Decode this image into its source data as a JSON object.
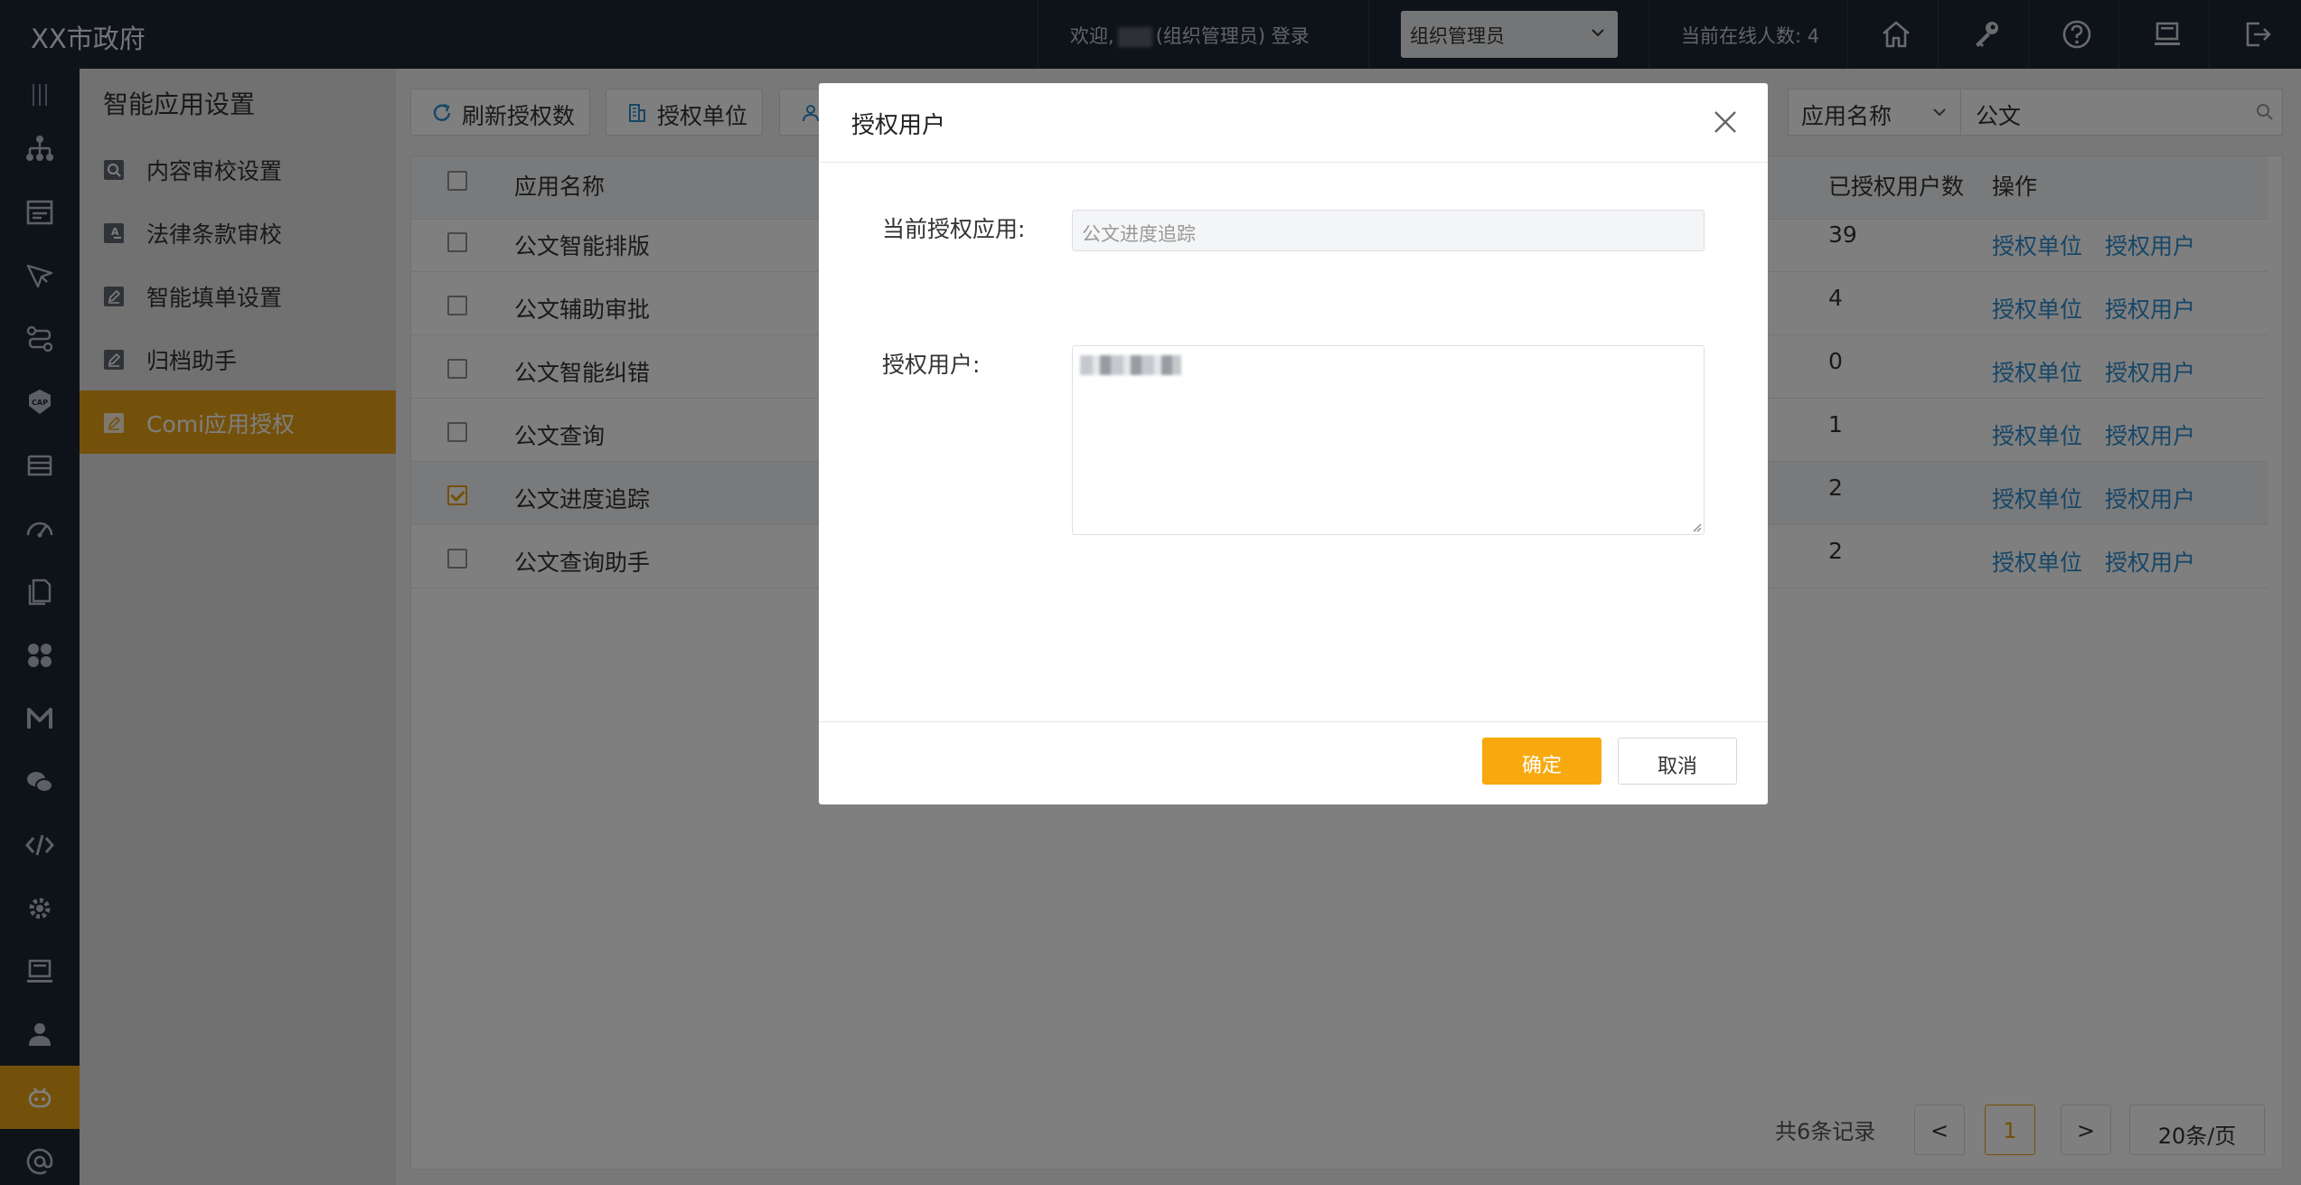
{
  "header": {
    "title": "XX市政府",
    "welcome_prefix": "欢迎,",
    "welcome_suffix": "(组织管理员) 登录",
    "role_value": "组织管理员",
    "online_text": "当前在线人数: 4"
  },
  "subnav": {
    "title": "智能应用设置",
    "items": [
      {
        "label": "内容审校设置"
      },
      {
        "label": "法律条款审校"
      },
      {
        "label": "智能填单设置"
      },
      {
        "label": "归档助手"
      },
      {
        "label": "Comi应用授权"
      }
    ]
  },
  "toolbar": {
    "refresh_label": "刷新授权数",
    "auth_unit_label": "授权单位",
    "search_type": "应用名称",
    "search_value": "公文"
  },
  "table": {
    "headers": {
      "name": "应用名称",
      "count": "已授权用户数",
      "ops": "操作"
    },
    "rows": [
      {
        "name": "公文智能排版",
        "count": "39",
        "op1": "授权单位",
        "op2": "授权用户",
        "checked": false
      },
      {
        "name": "公文辅助审批",
        "count": "4",
        "op1": "授权单位",
        "op2": "授权用户",
        "checked": false
      },
      {
        "name": "公文智能纠错",
        "count": "0",
        "op1": "授权单位",
        "op2": "授权用户",
        "checked": false
      },
      {
        "name": "公文查询",
        "count": "1",
        "op1": "授权单位",
        "op2": "授权用户",
        "checked": false
      },
      {
        "name": "公文进度追踪",
        "count": "2",
        "op1": "授权单位",
        "op2": "授权用户",
        "checked": true
      },
      {
        "name": "公文查询助手",
        "count": "2",
        "op1": "授权单位",
        "op2": "授权用户",
        "checked": false
      }
    ]
  },
  "pagination": {
    "total_text": "共6条记录",
    "prev": "<",
    "current_page": "1",
    "next": ">",
    "page_size": "20条/页"
  },
  "modal": {
    "title": "授权用户",
    "app_label": "当前授权应用:",
    "app_value": "公文进度追踪",
    "users_label": "授权用户:",
    "ok_label": "确定",
    "cancel_label": "取消"
  },
  "colors": {
    "header_bg": "#1d2733",
    "accent": "#e8a317",
    "confirm_button": "#f7a90f",
    "link": "#2d8ccf"
  }
}
